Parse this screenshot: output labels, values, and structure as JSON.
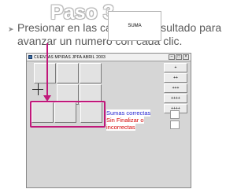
{
  "slide": {
    "title": "Paso 3",
    "bullet": "Presionar en las casillas el resultado para avanzar un numero con cada clic."
  },
  "window": {
    "title": "CUENTAS  MPIRAS  JPFA  ABRIL 2003",
    "sum_label": "SUMA",
    "operation_buttons": [
      "+",
      "++",
      "+++",
      "++++",
      "++++"
    ],
    "results": {
      "correct_label": "Sumas correctas",
      "unfinished_label": "Sin Finalizar o",
      "incorrect_label": "incorrectas"
    }
  },
  "colors": {
    "highlight": "#c0187a",
    "correct_text": "#1f1fd0",
    "incorrect_text": "#d40000"
  }
}
